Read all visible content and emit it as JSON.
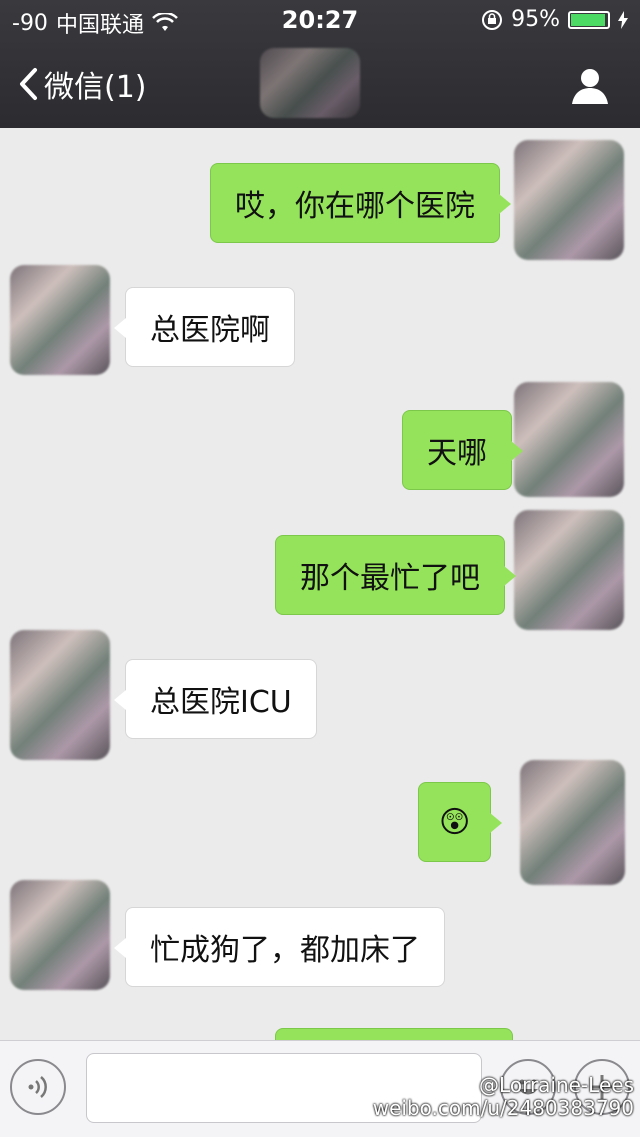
{
  "status_bar": {
    "signal": "-90",
    "carrier": "中国联通",
    "time": "20:27",
    "battery": "95%",
    "battery_level": 0.95
  },
  "nav": {
    "back_label": "微信(1)"
  },
  "messages": [
    {
      "dir": "out",
      "text": "哎，你在哪个医院"
    },
    {
      "dir": "in",
      "text": "总医院啊"
    },
    {
      "dir": "out",
      "text": "天哪"
    },
    {
      "dir": "out",
      "text": "那个最忙了吧"
    },
    {
      "dir": "in",
      "text": "总医院ICU"
    },
    {
      "dir": "out",
      "text": "😲",
      "icon": "shocked-emoji-icon"
    },
    {
      "dir": "in",
      "text": "忙成狗了，都加床了"
    }
  ],
  "watermark": {
    "name": "@Lorraine-Lees",
    "url": "weibo.com/u/2480383790"
  },
  "colors": {
    "outgoing_bubble": "#94e35a",
    "incoming_bubble": "#ffffff",
    "background": "#ebebeb"
  }
}
